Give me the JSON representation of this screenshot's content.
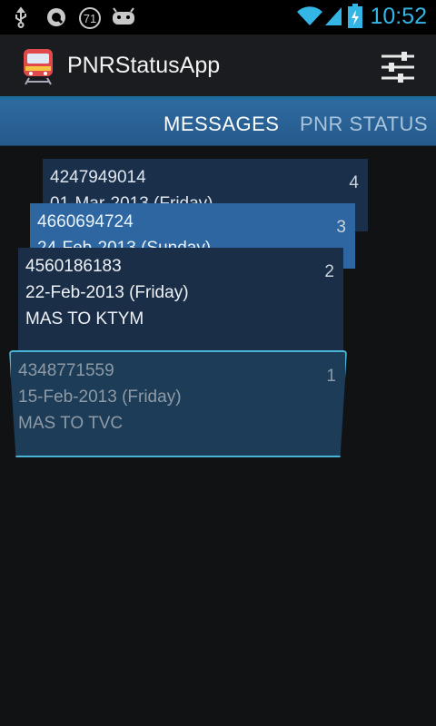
{
  "status_bar": {
    "time": "10:52",
    "notification_badge": "71",
    "icons": [
      "usb-icon",
      "sync-icon",
      "notification-count-icon",
      "android-icon",
      "wifi-icon",
      "signal-icon",
      "battery-charging-icon"
    ]
  },
  "action_bar": {
    "title": "PNRStatusApp",
    "app_icon": "train-icon",
    "settings_icon": "settings-sliders-icon"
  },
  "tabs": [
    {
      "label": "MESSAGES",
      "selected": true
    },
    {
      "label": "PNR STATUS",
      "selected": false
    }
  ],
  "cards": [
    {
      "pnr": "4247949014",
      "date": "01-Mar-2013 (Friday)",
      "route": "",
      "index": "4"
    },
    {
      "pnr": "4660694724",
      "date": "24-Feb-2013 (Sunday)",
      "route": "",
      "index": "3"
    },
    {
      "pnr": "4560186183",
      "date": "22-Feb-2013 (Friday)",
      "route": "MAS TO KTYM",
      "index": "2"
    },
    {
      "pnr": "4348771559",
      "date": "15-Feb-2013 (Friday)",
      "route": "MAS TO TVC",
      "index": "1"
    }
  ],
  "colors": {
    "accent": "#33b5e5",
    "tab_bar": "#2f6aa0",
    "background": "#101214"
  }
}
